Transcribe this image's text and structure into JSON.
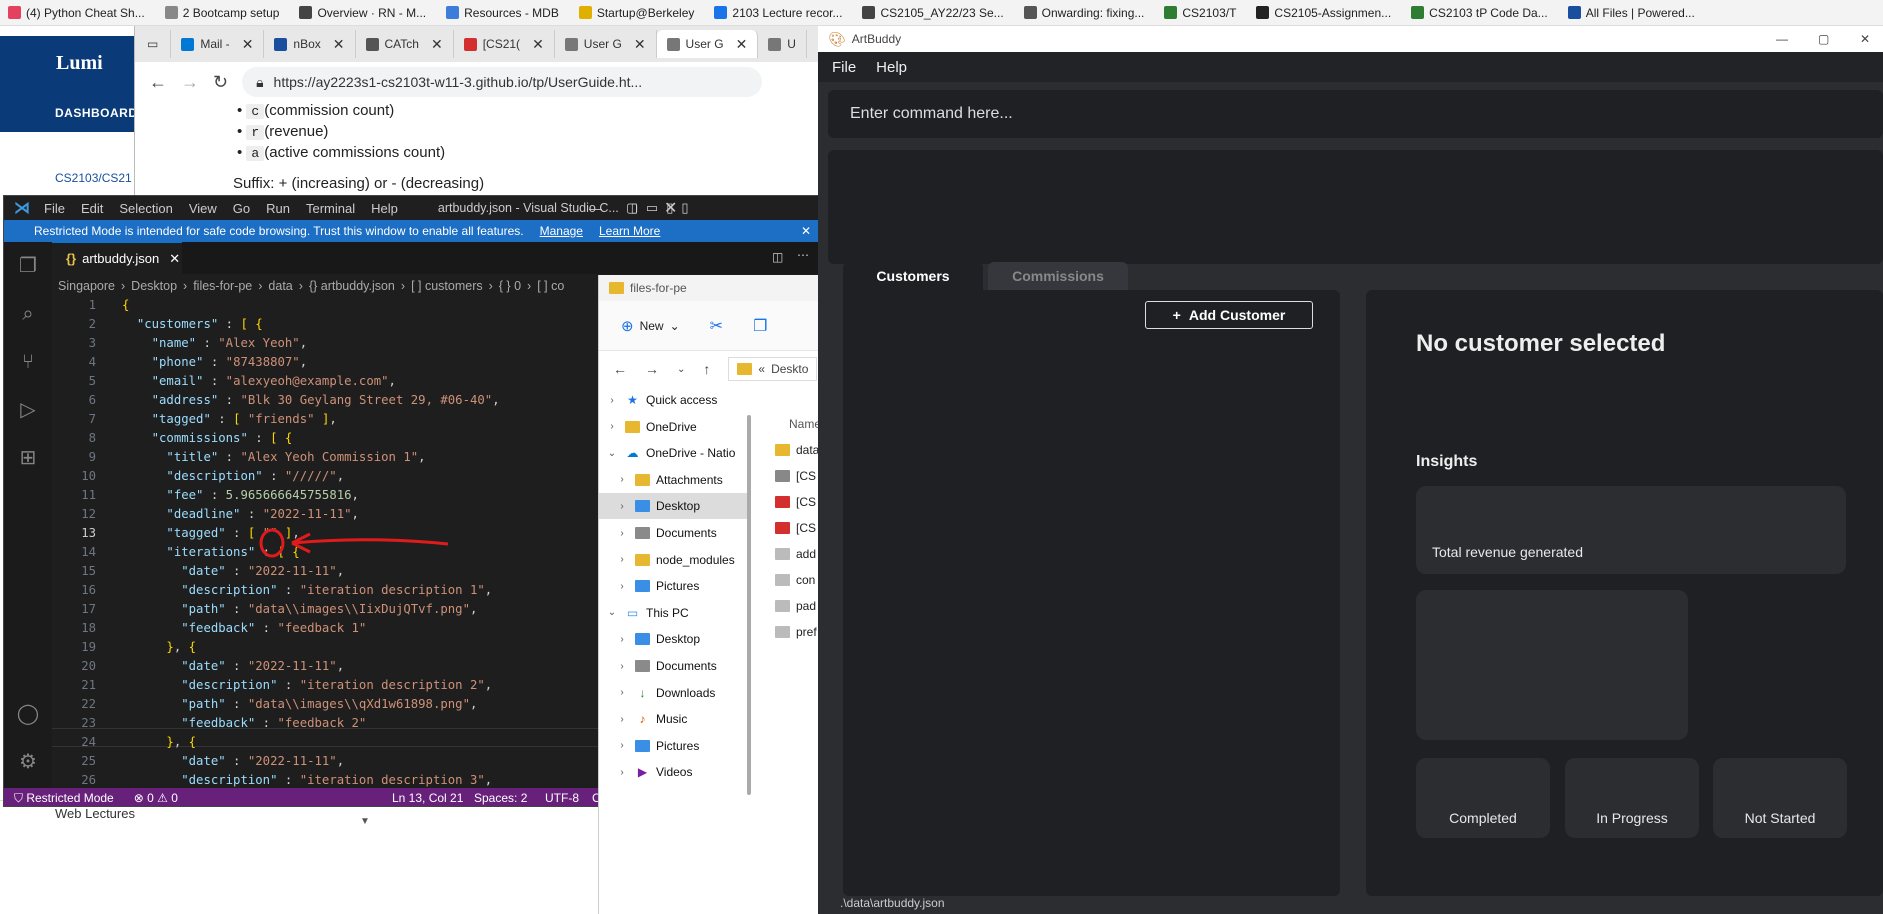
{
  "bookmarks": [
    {
      "label": "(4) Python Cheat Sh...",
      "color": "#e4405f"
    },
    {
      "label": "2 Bootcamp setup",
      "color": "#888888"
    },
    {
      "label": "Overview · RN - M...",
      "color": "#444444"
    },
    {
      "label": "Resources - MDB",
      "color": "#3b7dd8"
    },
    {
      "label": "Startup@Berkeley",
      "color": "#e0b000"
    },
    {
      "label": "2103 Lecture recor...",
      "color": "#1a73e8"
    },
    {
      "label": "CS2105_AY22/23 Se...",
      "color": "#444444"
    },
    {
      "label": "Onwarding: fixing...",
      "color": "#555555"
    },
    {
      "label": "CS2103/T",
      "color": "#2e7d32"
    },
    {
      "label": "CS2105-Assignmen...",
      "color": "#222222"
    },
    {
      "label": "CS2103 tP Code Da...",
      "color": "#2e7d32"
    },
    {
      "label": "All Files | Powered...",
      "color": "#1a4fa0"
    }
  ],
  "lumi": {
    "logo": "Lumi",
    "dashboard": "DASHBOARD",
    "course": "CS2103/CS21",
    "weblectures": "Web Lectures"
  },
  "browser": {
    "tabs": [
      {
        "label": "Mail -",
        "icon": "outlook-icon",
        "color": "#0078d4"
      },
      {
        "label": "nBox",
        "icon": "nbox-icon",
        "color": "#1a4fa0"
      },
      {
        "label": "CATch",
        "icon": "catch-icon",
        "color": "#555555"
      },
      {
        "label": "[CS21(",
        "icon": "pdf-icon",
        "color": "#d32f2f"
      },
      {
        "label": "User G",
        "icon": "doc-icon",
        "color": "#777777"
      },
      {
        "label": "User G",
        "icon": "doc-icon",
        "color": "#777777",
        "active": true
      },
      {
        "label": "U",
        "icon": "doc-icon",
        "color": "#777777"
      }
    ],
    "url": "https://ay2223s1-cs2103t-w11-3.github.io/tp/UserGuide.ht...",
    "bullets": [
      {
        "code": "c",
        "text": "(commission count)"
      },
      {
        "code": "r",
        "text": "(revenue)"
      },
      {
        "code": "a",
        "text": "(active commissions count)"
      }
    ],
    "suffix_line": "Suffix:  +  (increasing) or  -  (decreasing)"
  },
  "vscode": {
    "menu": [
      "File",
      "Edit",
      "Selection",
      "View",
      "Go",
      "Run",
      "Terminal",
      "Help"
    ],
    "title": "artbuddy.json - Visual Studio C...",
    "restricted_msg": "Restricted Mode is intended for safe code browsing. Trust this window to enable all features.",
    "manage": "Manage",
    "learn_more": "Learn More",
    "file_tab": "artbuddy.json",
    "breadcrumb": [
      "Singapore",
      "Desktop",
      "files-for-pe",
      "data",
      "{} artbuddy.json",
      "[ ] customers",
      "{ } 0",
      "[ ] co"
    ],
    "status": {
      "mode": "Restricted Mode",
      "problems": "⊗ 0  ⚠ 0",
      "position": "Ln 13, Col 21",
      "spaces": "Spaces: 2",
      "encoding": "UTF-8",
      "extra": "C"
    },
    "lines": [
      "{",
      "  \"customers\" : [ {",
      "    \"name\" : \"Alex Yeoh\",",
      "    \"phone\" : \"87438807\",",
      "    \"email\" : \"alexyeoh@example.com\",",
      "    \"address\" : \"Blk 30 Geylang Street 29, #06-40\",",
      "    \"tagged\" : [ \"friends\" ],",
      "    \"commissions\" : [ {",
      "      \"title\" : \"Alex Yeoh Commission 1\",",
      "      \"description\" : \"/////\",",
      "      \"fee\" : 5.965666645755816,",
      "      \"deadline\" : \"2022-11-11\",",
      "      \"tagged\" : [ \"\" ],",
      "      \"iterations\" : [ {",
      "        \"date\" : \"2022-11-11\",",
      "        \"description\" : \"iteration description 1\",",
      "        \"path\" : \"data\\\\images\\\\IixDujQTvf.png\",",
      "        \"feedback\" : \"feedback 1\"",
      "      }, {",
      "        \"date\" : \"2022-11-11\",",
      "        \"description\" : \"iteration description 2\",",
      "        \"path\" : \"data\\\\images\\\\qXd1w61898.png\",",
      "        \"feedback\" : \"feedback 2\"",
      "      }, {",
      "        \"date\" : \"2022-11-11\",",
      "        \"description\" : \"iteration description 3\","
    ],
    "current_line": 13
  },
  "explorer": {
    "title": "files-for-pe",
    "new_label": "New",
    "path": "Deskto",
    "name_header": "Name",
    "tree": [
      {
        "label": "Quick access",
        "icon": "star",
        "color": "#1a73e8",
        "indent": 0
      },
      {
        "label": "OneDrive",
        "icon": "folder",
        "color": "#e8b730",
        "indent": 0
      },
      {
        "label": "OneDrive - Natio",
        "icon": "cloud",
        "color": "#0078d4",
        "indent": 0,
        "open": true
      },
      {
        "label": "Attachments",
        "icon": "folder",
        "color": "#e8b730",
        "indent": 1
      },
      {
        "label": "Desktop",
        "icon": "folder",
        "color": "#3a8ee6",
        "indent": 1,
        "selected": true
      },
      {
        "label": "Documents",
        "icon": "folder",
        "color": "#8a8a8a",
        "indent": 1
      },
      {
        "label": "node_modules",
        "icon": "folder",
        "color": "#e8b730",
        "indent": 1
      },
      {
        "label": "Pictures",
        "icon": "folder",
        "color": "#3a8ee6",
        "indent": 1
      },
      {
        "label": "This PC",
        "icon": "pc",
        "color": "#3a8ee6",
        "indent": 0,
        "open": true
      },
      {
        "label": "Desktop",
        "icon": "folder",
        "color": "#3a8ee6",
        "indent": 1
      },
      {
        "label": "Documents",
        "icon": "folder",
        "color": "#8a8a8a",
        "indent": 1
      },
      {
        "label": "Downloads",
        "icon": "download",
        "color": "#2e7d32",
        "indent": 1
      },
      {
        "label": "Music",
        "icon": "music",
        "color": "#e65100",
        "indent": 1
      },
      {
        "label": "Pictures",
        "icon": "folder",
        "color": "#3a8ee6",
        "indent": 1
      },
      {
        "label": "Videos",
        "icon": "video",
        "color": "#7b1fa2",
        "indent": 1
      }
    ],
    "files": [
      {
        "label": "data",
        "color": "#e8b730"
      },
      {
        "label": "[CS",
        "color": "#888888"
      },
      {
        "label": "[CS",
        "color": "#d32f2f"
      },
      {
        "label": "[CS",
        "color": "#d32f2f"
      },
      {
        "label": "add",
        "color": "#bbbbbb"
      },
      {
        "label": "con",
        "color": "#bbbbbb"
      },
      {
        "label": "pad",
        "color": "#bbbbbb"
      },
      {
        "label": "pref",
        "color": "#bbbbbb"
      }
    ]
  },
  "artbuddy": {
    "title": "ArtBuddy",
    "menu": [
      "File",
      "Help"
    ],
    "command_placeholder": "Enter command here...",
    "tabs": [
      "Customers",
      "Commissions"
    ],
    "add_customer": "Add Customer",
    "no_customer": "No customer selected",
    "insights": "Insights",
    "total_revenue": "Total revenue generated",
    "statuses": [
      "Completed",
      "In Progress",
      "Not Started"
    ],
    "footer_path": ".\\data\\artbuddy.json"
  },
  "colors": {
    "vscode_accent": "#1c6fc4",
    "status_bar": "#68217a",
    "annotation": "#e01b1b"
  }
}
